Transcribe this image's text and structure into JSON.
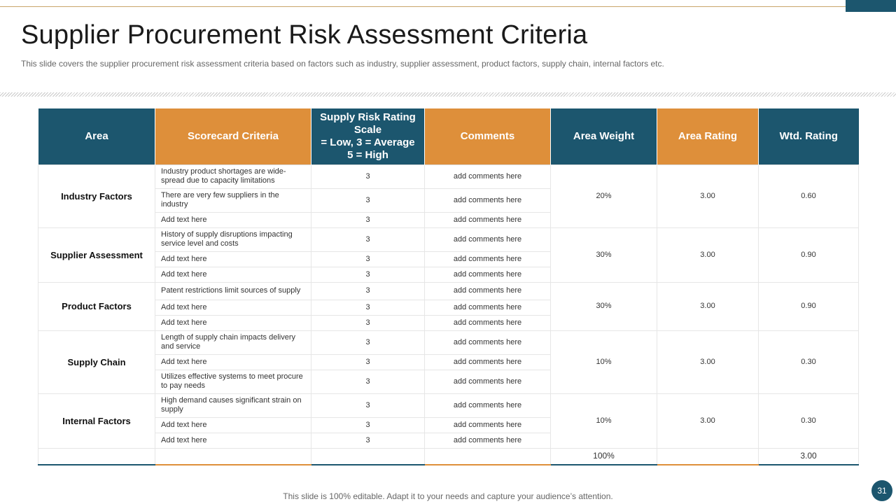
{
  "slide": {
    "title": "Supplier Procurement Risk Assessment Criteria",
    "subtitle": "This slide covers the supplier procurement risk assessment criteria based on factors such as industry, supplier assessment, product factors, supply chain, internal factors etc.",
    "footer": "This slide is 100% editable. Adapt it to your needs and capture your audience’s attention.",
    "page_number": "31"
  },
  "colors": {
    "accent_blue": "#1c566e",
    "accent_orange": "#de8f3a"
  },
  "table": {
    "headers": [
      {
        "label": "Area",
        "color": "blue"
      },
      {
        "label": "Scorecard Criteria",
        "color": "orange"
      },
      {
        "label": "Supply Risk Rating Scale\n= Low, 3 = Average\n5 = High",
        "color": "blue"
      },
      {
        "label": "Comments",
        "color": "orange"
      },
      {
        "label": "Area Weight",
        "color": "blue"
      },
      {
        "label": "Area Rating",
        "color": "orange"
      },
      {
        "label": "Wtd. Rating",
        "color": "blue"
      }
    ],
    "groups": [
      {
        "area": "Industry Factors",
        "weight": "20%",
        "rating": "3.00",
        "wtd": "0.60",
        "rows": [
          {
            "criteria": "Industry product shortages are wide-spread due to capacity limitations",
            "score": "3",
            "comment": "add comments here"
          },
          {
            "criteria": "There are very few suppliers in  the industry",
            "score": "3",
            "comment": "add comments here"
          },
          {
            "criteria": "Add text here",
            "score": "3",
            "comment": "add comments here"
          }
        ]
      },
      {
        "area": "Supplier Assessment",
        "weight": "30%",
        "rating": "3.00",
        "wtd": "0.90",
        "rows": [
          {
            "criteria": "History of supply disruptions impacting service level and costs",
            "score": "3",
            "comment": "add comments here"
          },
          {
            "criteria": "Add text here",
            "score": "3",
            "comment": "add comments here"
          },
          {
            "criteria": "Add text here",
            "score": "3",
            "comment": "add comments here"
          }
        ]
      },
      {
        "area": "Product Factors",
        "weight": "30%",
        "rating": "3.00",
        "wtd": "0.90",
        "rows": [
          {
            "criteria": "Patent restrictions limit sources of supply",
            "score": "3",
            "comment": "add comments here"
          },
          {
            "criteria": "Add text here",
            "score": "3",
            "comment": "add comments here"
          },
          {
            "criteria": "Add text here",
            "score": "3",
            "comment": "add comments here"
          }
        ]
      },
      {
        "area": "Supply Chain",
        "weight": "10%",
        "rating": "3.00",
        "wtd": "0.30",
        "rows": [
          {
            "criteria": "Length of supply chain impacts delivery and service",
            "score": "3",
            "comment": "add comments here"
          },
          {
            "criteria": "Add text here",
            "score": "3",
            "comment": "add comments here"
          },
          {
            "criteria": "Utilizes effective systems to meet procure to pay needs",
            "score": "3",
            "comment": "add comments here"
          }
        ]
      },
      {
        "area": "Internal Factors",
        "weight": "10%",
        "rating": "3.00",
        "wtd": "0.30",
        "rows": [
          {
            "criteria": "High demand causes significant strain on supply",
            "score": "3",
            "comment": "add comments here"
          },
          {
            "criteria": "Add text here",
            "score": "3",
            "comment": "add comments here"
          },
          {
            "criteria": "Add text here",
            "score": "3",
            "comment": "add comments here"
          }
        ]
      }
    ],
    "totals": {
      "weight": "100%",
      "wtd": "3.00"
    }
  }
}
